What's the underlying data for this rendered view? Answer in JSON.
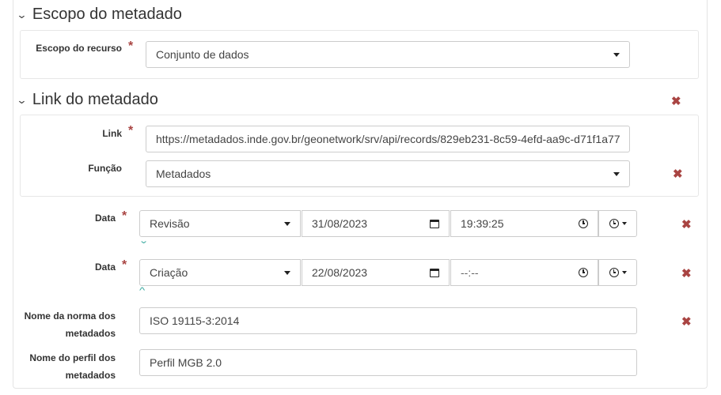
{
  "sections": {
    "escopo": {
      "title": "Escopo do metadado"
    },
    "link": {
      "title": "Link do metadado"
    }
  },
  "fields": {
    "escopo_recurso": {
      "label": "Escopo do recurso",
      "value": "Conjunto de dados"
    },
    "link": {
      "label": "Link",
      "value": "https://metadados.inde.gov.br/geonetwork/srv/api/records/829eb231-8c59-4efd-aa9c-d71f1a77"
    },
    "funcao": {
      "label": "Função",
      "value": "Metadados"
    },
    "data1": {
      "label": "Data",
      "type": "Revisão",
      "date": "31/08/2023",
      "time": "19:39:25"
    },
    "data2": {
      "label": "Data",
      "type": "Criação",
      "date": "22/08/2023",
      "time": "--:--"
    },
    "norma": {
      "label_line1": "Nome da norma dos",
      "label_line2": "metadados",
      "value": "ISO 19115-3:2014"
    },
    "perfil": {
      "label_line1": "Nome do perfil dos",
      "label_line2": "metadados",
      "value": "Perfil MGB 2.0"
    }
  },
  "required_marker": "*",
  "icons": {
    "remove": "✖",
    "chevron_down": "⌄",
    "chevron_up": "^"
  },
  "colors": {
    "remove": "#a94442",
    "toggle": "#3aa99f"
  }
}
